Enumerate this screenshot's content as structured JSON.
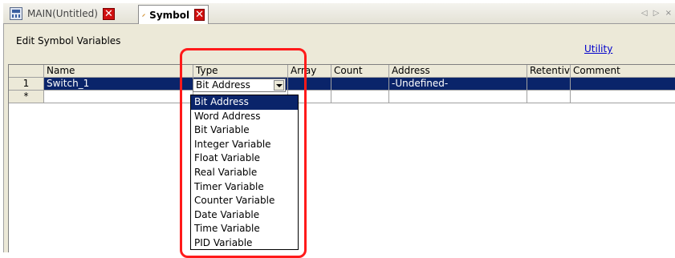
{
  "tabs": [
    {
      "label": "MAIN(Untitled)",
      "icon": "screen-icon"
    },
    {
      "label": "Symbol",
      "icon": "pen-icon"
    }
  ],
  "tab_arrows": "◁ ▷ ×",
  "header": {
    "title": "Edit Symbol Variables",
    "utility_link": "Utility"
  },
  "grid": {
    "columns": [
      "Name",
      "Type",
      "Array",
      "Count",
      "Address",
      "Retentiv",
      "Comment"
    ],
    "rows": [
      {
        "num": "1",
        "name": "Switch_1",
        "type": "Bit Address",
        "array": "",
        "count": "",
        "address": "-Undefined-",
        "retentiv": "",
        "comment": ""
      }
    ],
    "new_row_marker": "*"
  },
  "dropdown": {
    "selected": "Bit Address",
    "options": [
      "Bit Address",
      "Word Address",
      "Bit Variable",
      "Integer Variable",
      "Float Variable",
      "Real Variable",
      "Timer Variable",
      "Counter Variable",
      "Date Variable",
      "Time Variable",
      "PID Variable"
    ]
  },
  "colors": {
    "selection": "#0a246a",
    "highlight": "#ff1a1a",
    "close": "#d01010",
    "link": "#0000cc"
  }
}
